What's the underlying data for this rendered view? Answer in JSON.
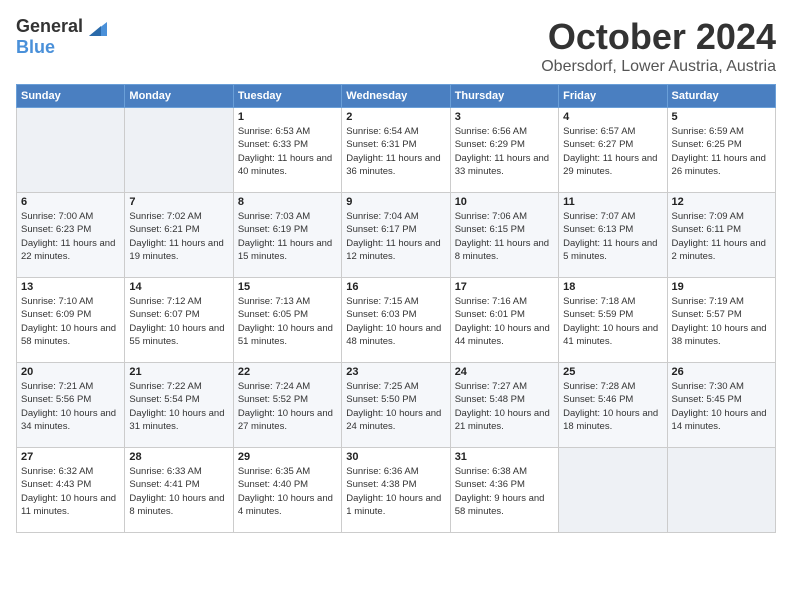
{
  "logo": {
    "general": "General",
    "blue": "Blue"
  },
  "title": "October 2024",
  "location": "Obersdorf, Lower Austria, Austria",
  "weekdays": [
    "Sunday",
    "Monday",
    "Tuesday",
    "Wednesday",
    "Thursday",
    "Friday",
    "Saturday"
  ],
  "weeks": [
    [
      {
        "day": "",
        "sunrise": "",
        "sunset": "",
        "daylight": ""
      },
      {
        "day": "",
        "sunrise": "",
        "sunset": "",
        "daylight": ""
      },
      {
        "day": "1",
        "sunrise": "Sunrise: 6:53 AM",
        "sunset": "Sunset: 6:33 PM",
        "daylight": "Daylight: 11 hours and 40 minutes."
      },
      {
        "day": "2",
        "sunrise": "Sunrise: 6:54 AM",
        "sunset": "Sunset: 6:31 PM",
        "daylight": "Daylight: 11 hours and 36 minutes."
      },
      {
        "day": "3",
        "sunrise": "Sunrise: 6:56 AM",
        "sunset": "Sunset: 6:29 PM",
        "daylight": "Daylight: 11 hours and 33 minutes."
      },
      {
        "day": "4",
        "sunrise": "Sunrise: 6:57 AM",
        "sunset": "Sunset: 6:27 PM",
        "daylight": "Daylight: 11 hours and 29 minutes."
      },
      {
        "day": "5",
        "sunrise": "Sunrise: 6:59 AM",
        "sunset": "Sunset: 6:25 PM",
        "daylight": "Daylight: 11 hours and 26 minutes."
      }
    ],
    [
      {
        "day": "6",
        "sunrise": "Sunrise: 7:00 AM",
        "sunset": "Sunset: 6:23 PM",
        "daylight": "Daylight: 11 hours and 22 minutes."
      },
      {
        "day": "7",
        "sunrise": "Sunrise: 7:02 AM",
        "sunset": "Sunset: 6:21 PM",
        "daylight": "Daylight: 11 hours and 19 minutes."
      },
      {
        "day": "8",
        "sunrise": "Sunrise: 7:03 AM",
        "sunset": "Sunset: 6:19 PM",
        "daylight": "Daylight: 11 hours and 15 minutes."
      },
      {
        "day": "9",
        "sunrise": "Sunrise: 7:04 AM",
        "sunset": "Sunset: 6:17 PM",
        "daylight": "Daylight: 11 hours and 12 minutes."
      },
      {
        "day": "10",
        "sunrise": "Sunrise: 7:06 AM",
        "sunset": "Sunset: 6:15 PM",
        "daylight": "Daylight: 11 hours and 8 minutes."
      },
      {
        "day": "11",
        "sunrise": "Sunrise: 7:07 AM",
        "sunset": "Sunset: 6:13 PM",
        "daylight": "Daylight: 11 hours and 5 minutes."
      },
      {
        "day": "12",
        "sunrise": "Sunrise: 7:09 AM",
        "sunset": "Sunset: 6:11 PM",
        "daylight": "Daylight: 11 hours and 2 minutes."
      }
    ],
    [
      {
        "day": "13",
        "sunrise": "Sunrise: 7:10 AM",
        "sunset": "Sunset: 6:09 PM",
        "daylight": "Daylight: 10 hours and 58 minutes."
      },
      {
        "day": "14",
        "sunrise": "Sunrise: 7:12 AM",
        "sunset": "Sunset: 6:07 PM",
        "daylight": "Daylight: 10 hours and 55 minutes."
      },
      {
        "day": "15",
        "sunrise": "Sunrise: 7:13 AM",
        "sunset": "Sunset: 6:05 PM",
        "daylight": "Daylight: 10 hours and 51 minutes."
      },
      {
        "day": "16",
        "sunrise": "Sunrise: 7:15 AM",
        "sunset": "Sunset: 6:03 PM",
        "daylight": "Daylight: 10 hours and 48 minutes."
      },
      {
        "day": "17",
        "sunrise": "Sunrise: 7:16 AM",
        "sunset": "Sunset: 6:01 PM",
        "daylight": "Daylight: 10 hours and 44 minutes."
      },
      {
        "day": "18",
        "sunrise": "Sunrise: 7:18 AM",
        "sunset": "Sunset: 5:59 PM",
        "daylight": "Daylight: 10 hours and 41 minutes."
      },
      {
        "day": "19",
        "sunrise": "Sunrise: 7:19 AM",
        "sunset": "Sunset: 5:57 PM",
        "daylight": "Daylight: 10 hours and 38 minutes."
      }
    ],
    [
      {
        "day": "20",
        "sunrise": "Sunrise: 7:21 AM",
        "sunset": "Sunset: 5:56 PM",
        "daylight": "Daylight: 10 hours and 34 minutes."
      },
      {
        "day": "21",
        "sunrise": "Sunrise: 7:22 AM",
        "sunset": "Sunset: 5:54 PM",
        "daylight": "Daylight: 10 hours and 31 minutes."
      },
      {
        "day": "22",
        "sunrise": "Sunrise: 7:24 AM",
        "sunset": "Sunset: 5:52 PM",
        "daylight": "Daylight: 10 hours and 27 minutes."
      },
      {
        "day": "23",
        "sunrise": "Sunrise: 7:25 AM",
        "sunset": "Sunset: 5:50 PM",
        "daylight": "Daylight: 10 hours and 24 minutes."
      },
      {
        "day": "24",
        "sunrise": "Sunrise: 7:27 AM",
        "sunset": "Sunset: 5:48 PM",
        "daylight": "Daylight: 10 hours and 21 minutes."
      },
      {
        "day": "25",
        "sunrise": "Sunrise: 7:28 AM",
        "sunset": "Sunset: 5:46 PM",
        "daylight": "Daylight: 10 hours and 18 minutes."
      },
      {
        "day": "26",
        "sunrise": "Sunrise: 7:30 AM",
        "sunset": "Sunset: 5:45 PM",
        "daylight": "Daylight: 10 hours and 14 minutes."
      }
    ],
    [
      {
        "day": "27",
        "sunrise": "Sunrise: 6:32 AM",
        "sunset": "Sunset: 4:43 PM",
        "daylight": "Daylight: 10 hours and 11 minutes."
      },
      {
        "day": "28",
        "sunrise": "Sunrise: 6:33 AM",
        "sunset": "Sunset: 4:41 PM",
        "daylight": "Daylight: 10 hours and 8 minutes."
      },
      {
        "day": "29",
        "sunrise": "Sunrise: 6:35 AM",
        "sunset": "Sunset: 4:40 PM",
        "daylight": "Daylight: 10 hours and 4 minutes."
      },
      {
        "day": "30",
        "sunrise": "Sunrise: 6:36 AM",
        "sunset": "Sunset: 4:38 PM",
        "daylight": "Daylight: 10 hours and 1 minute."
      },
      {
        "day": "31",
        "sunrise": "Sunrise: 6:38 AM",
        "sunset": "Sunset: 4:36 PM",
        "daylight": "Daylight: 9 hours and 58 minutes."
      },
      {
        "day": "",
        "sunrise": "",
        "sunset": "",
        "daylight": ""
      },
      {
        "day": "",
        "sunrise": "",
        "sunset": "",
        "daylight": ""
      }
    ]
  ]
}
